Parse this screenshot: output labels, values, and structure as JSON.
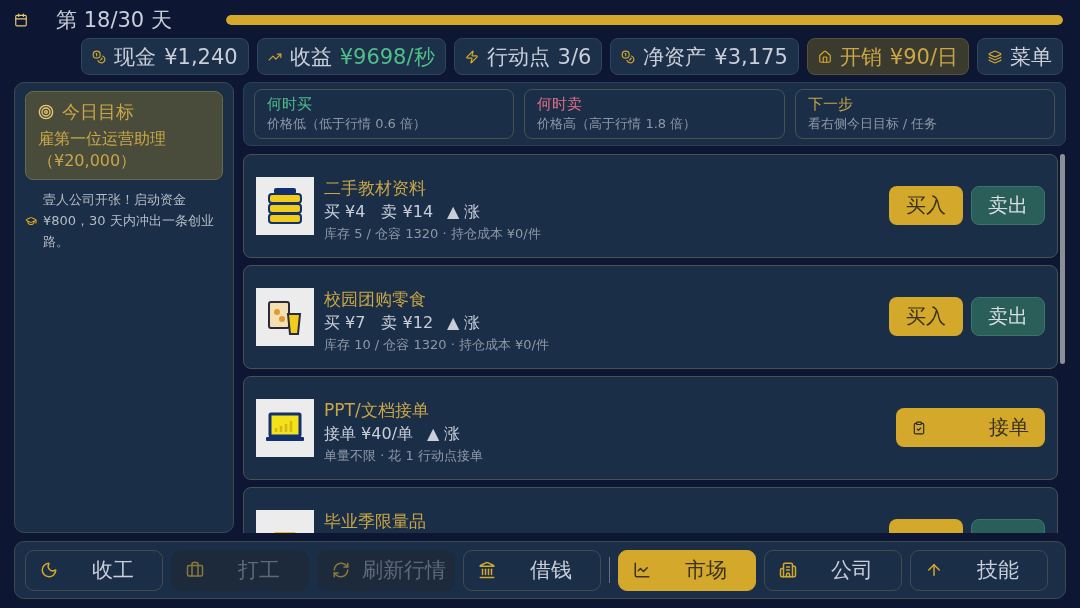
{
  "header": {
    "day": "第 18/30 天",
    "progress": {
      "level": 1
    }
  },
  "stats": [
    {
      "kind": "cash",
      "label": "现金",
      "value": "¥1,240"
    },
    {
      "kind": "income",
      "label": "收益",
      "value": "¥9698/秒"
    },
    {
      "kind": "action",
      "label": "行动点",
      "value": "3/6"
    },
    {
      "kind": "assets",
      "label": "净资产",
      "value": "¥3,175"
    },
    {
      "kind": "expense",
      "label": "开销",
      "value": "¥90/日"
    },
    {
      "kind": "menu",
      "label": "菜单"
    }
  ],
  "goal": {
    "title": "今日目标",
    "text": "雇第一位运营助理（¥20,000）"
  },
  "log": "壹人公司开张！启动资金 ¥800，30 天内冲出一条创业路。",
  "tips": [
    {
      "kind": "buy",
      "title": "何时买",
      "text": "价格低（低于行情 0.6 倍）"
    },
    {
      "kind": "sell",
      "title": "何时卖",
      "text": "价格高（高于行情 1.8 倍）"
    },
    {
      "kind": "next",
      "title": "下一步",
      "text": "看右侧今日目标 / 任务"
    }
  ],
  "items": [
    {
      "kind": "books",
      "name": "二手教材资料",
      "price": "买 ¥4　卖 ¥14",
      "trend": "▲ 涨",
      "detail": "库存 5 / 仓容 1320 · 持仓成本 ¥0/件",
      "actions": [
        {
          "kind": "buy",
          "label": "买入"
        },
        {
          "kind": "sell",
          "label": "卖出"
        }
      ]
    },
    {
      "kind": "snack",
      "name": "校园团购零食",
      "price": "买 ¥7　卖 ¥12",
      "trend": "▲ 涨",
      "detail": "库存 10 / 仓容 1320 · 持仓成本 ¥0/件",
      "actions": [
        {
          "kind": "buy",
          "label": "买入"
        },
        {
          "kind": "sell",
          "label": "卖出"
        }
      ]
    },
    {
      "kind": "laptop",
      "name": "PPT/文档接单",
      "price": "接单 ¥40/单",
      "trend": "▲ 涨",
      "detail": "单量不限 · 花 1 行动点接单",
      "actions": [
        {
          "kind": "order",
          "label": "接单"
        }
      ]
    },
    {
      "kind": "cap",
      "name": "毕业季限量品",
      "actions": [
        {
          "kind": "buy"
        },
        {
          "kind": "sell"
        }
      ]
    }
  ],
  "nav": [
    {
      "kind": "rest",
      "label": "收工",
      "selected": false,
      "disabled": false
    },
    {
      "kind": "work",
      "label": "打工",
      "selected": false,
      "disabled": true
    },
    {
      "kind": "refresh",
      "label": "刷新行情",
      "selected": false,
      "disabled": true
    },
    {
      "kind": "loan",
      "label": "借钱",
      "selected": false,
      "disabled": false
    },
    {
      "kind": "market",
      "label": "市场",
      "selected": true,
      "disabled": false
    },
    {
      "kind": "company",
      "label": "公司",
      "selected": false,
      "disabled": false
    },
    {
      "kind": "skills",
      "label": "技能",
      "selected": false,
      "disabled": false
    }
  ]
}
